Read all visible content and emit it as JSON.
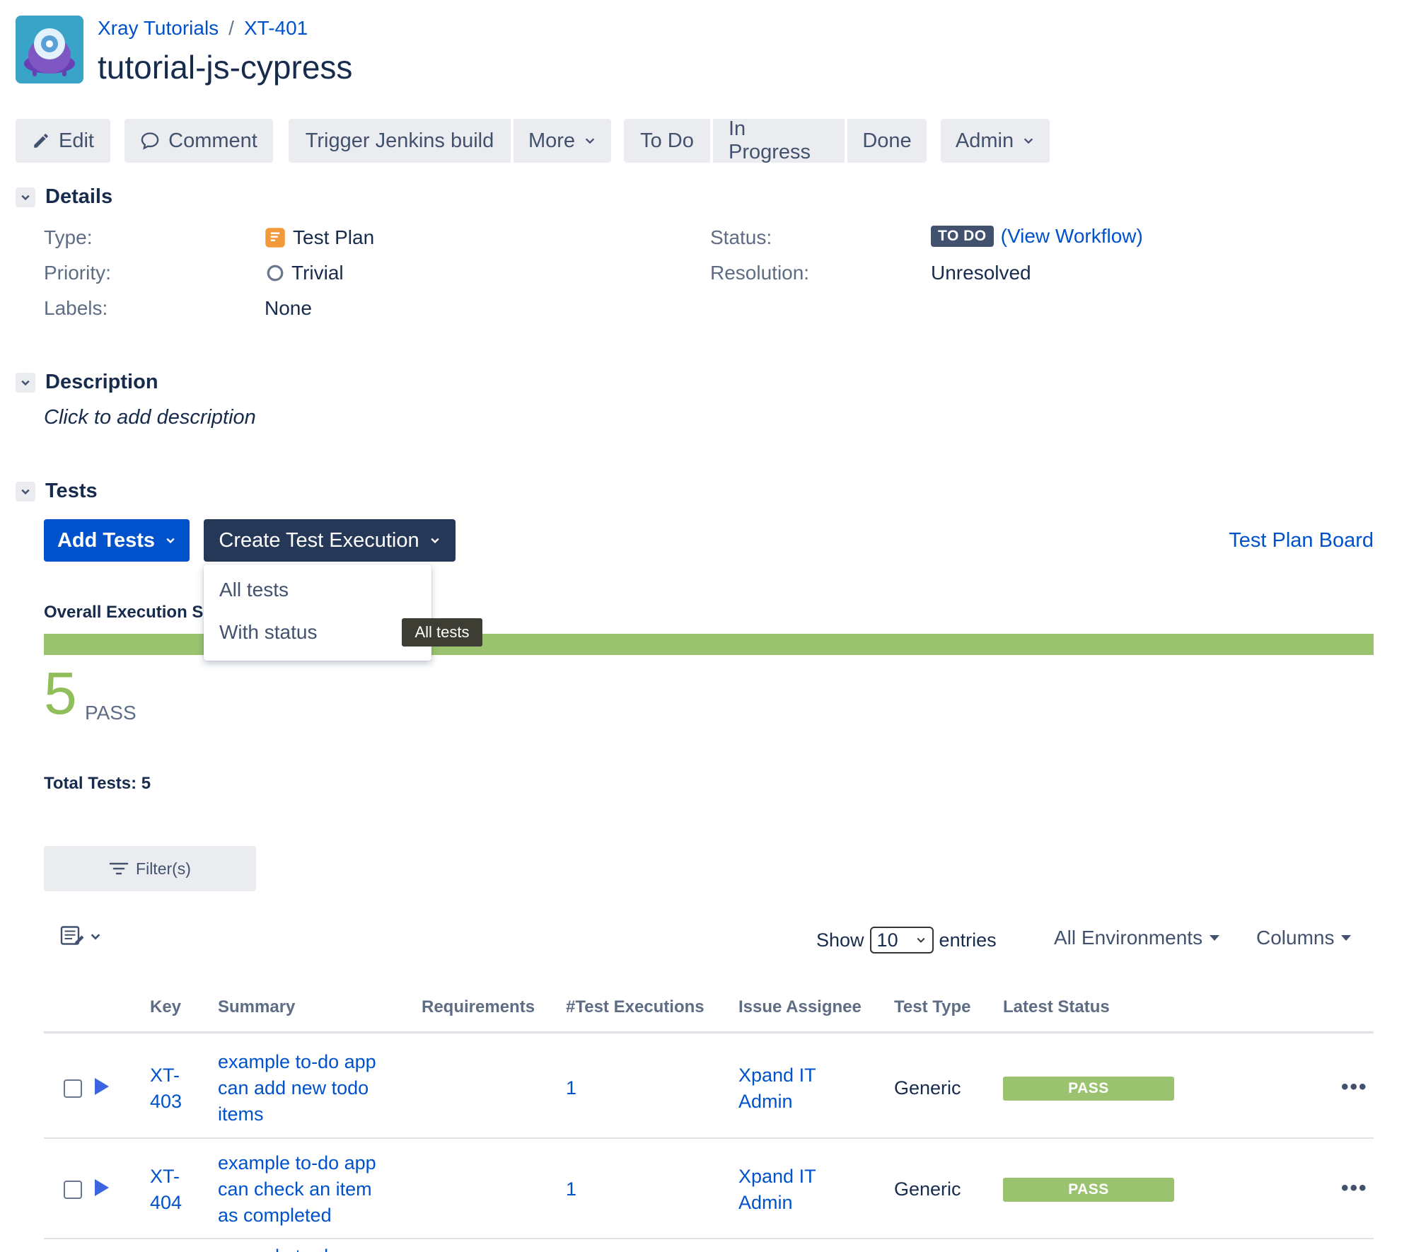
{
  "breadcrumb": {
    "project": "Xray Tutorials",
    "separator": "/",
    "issue_key": "XT-401"
  },
  "title": "tutorial-js-cypress",
  "toolbar": {
    "edit": "Edit",
    "comment": "Comment",
    "jenkins": "Trigger Jenkins build",
    "more": "More",
    "todo": "To Do",
    "in_progress": "In Progress",
    "done": "Done",
    "admin": "Admin"
  },
  "details": {
    "heading": "Details",
    "type_label": "Type:",
    "type_value": "Test Plan",
    "priority_label": "Priority:",
    "priority_value": "Trivial",
    "labels_label": "Labels:",
    "labels_value": "None",
    "status_label": "Status:",
    "status_value": "TO DO",
    "view_workflow_open": "(",
    "view_workflow": "View Workflow",
    "view_workflow_close": ")",
    "resolution_label": "Resolution:",
    "resolution_value": "Unresolved"
  },
  "description": {
    "heading": "Description",
    "placeholder": "Click to add description"
  },
  "tests": {
    "heading": "Tests",
    "add_tests": "Add Tests",
    "create_execution": "Create Test Execution",
    "plan_board": "Test Plan Board",
    "overall_label": "Overall Execution S",
    "progress_pass_fraction": 1.0,
    "dropdown": [
      "All tests",
      "With status"
    ],
    "tooltip": "All tests",
    "pass_count": "5",
    "pass_label": "PASS",
    "total_tests": "Total Tests: 5",
    "filter": "Filter(s)",
    "show": "Show",
    "entries_value": "10",
    "entries": "entries",
    "environments": "All Environments",
    "columns": "Columns"
  },
  "table": {
    "headers": [
      "Key",
      "Summary",
      "Requirements",
      "#Test Executions",
      "Issue Assignee",
      "Test Type",
      "Latest Status"
    ],
    "rows": [
      {
        "key_l1": "XT-",
        "key_l2": "403",
        "summary_l1": "example to-do app",
        "summary_l2": "can add new todo",
        "summary_l3": "items",
        "executions": "1",
        "assignee_l1": "Xpand IT",
        "assignee_l2": "Admin",
        "type": "Generic",
        "status": "PASS"
      },
      {
        "key_l1": "XT-",
        "key_l2": "404",
        "summary_l1": "example to-do app",
        "summary_l2": "can check an item",
        "summary_l3": "as completed",
        "executions": "1",
        "assignee_l1": "Xpand IT",
        "assignee_l2": "Admin",
        "type": "Generic",
        "status": "PASS"
      }
    ],
    "partial_row_summary": "example to-do app"
  },
  "colors": {
    "link": "#0052cc",
    "pass": "#9bc36f",
    "primary": "#0052cc",
    "dark_button": "#253858"
  }
}
